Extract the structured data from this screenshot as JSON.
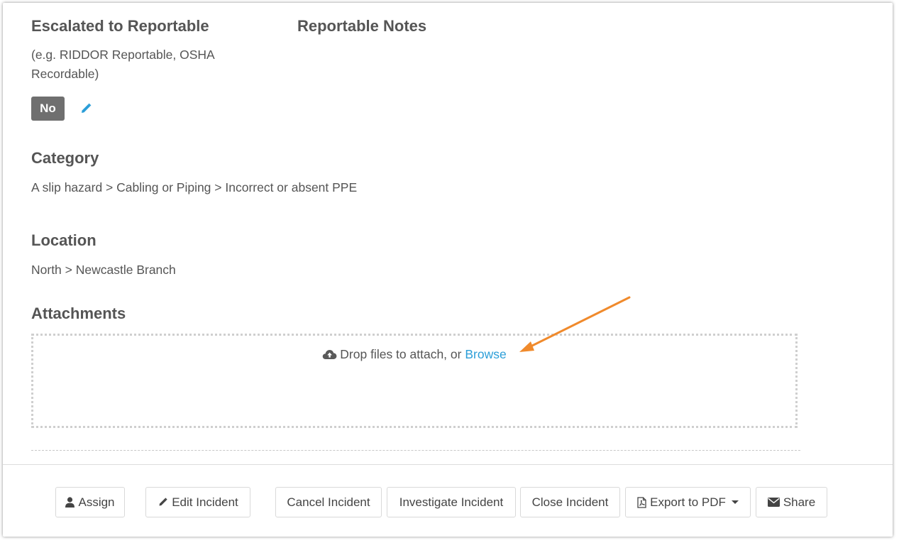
{
  "escalated": {
    "heading": "Escalated to Reportable",
    "hint_line1": "(e.g. RIDDOR Reportable, OSHA",
    "hint_line2": "Recordable)",
    "value": "No"
  },
  "reportable_notes": {
    "heading": "Reportable Notes"
  },
  "category": {
    "heading": "Category",
    "value": "A slip hazard > Cabling or Piping > Incorrect or absent PPE"
  },
  "location": {
    "heading": "Location",
    "value": "North > Newcastle Branch"
  },
  "attachments": {
    "heading": "Attachments",
    "drop_text": "Drop files to attach, or",
    "browse_label": "Browse"
  },
  "actions": {
    "assign": "Assign",
    "edit": "Edit Incident",
    "cancel": "Cancel Incident",
    "investigate": "Investigate Incident",
    "close": "Close Incident",
    "export": "Export to PDF",
    "share": "Share"
  },
  "colors": {
    "link": "#2b9ed8",
    "badge": "#6f6f6f",
    "annotation_arrow": "#f08a2c"
  }
}
